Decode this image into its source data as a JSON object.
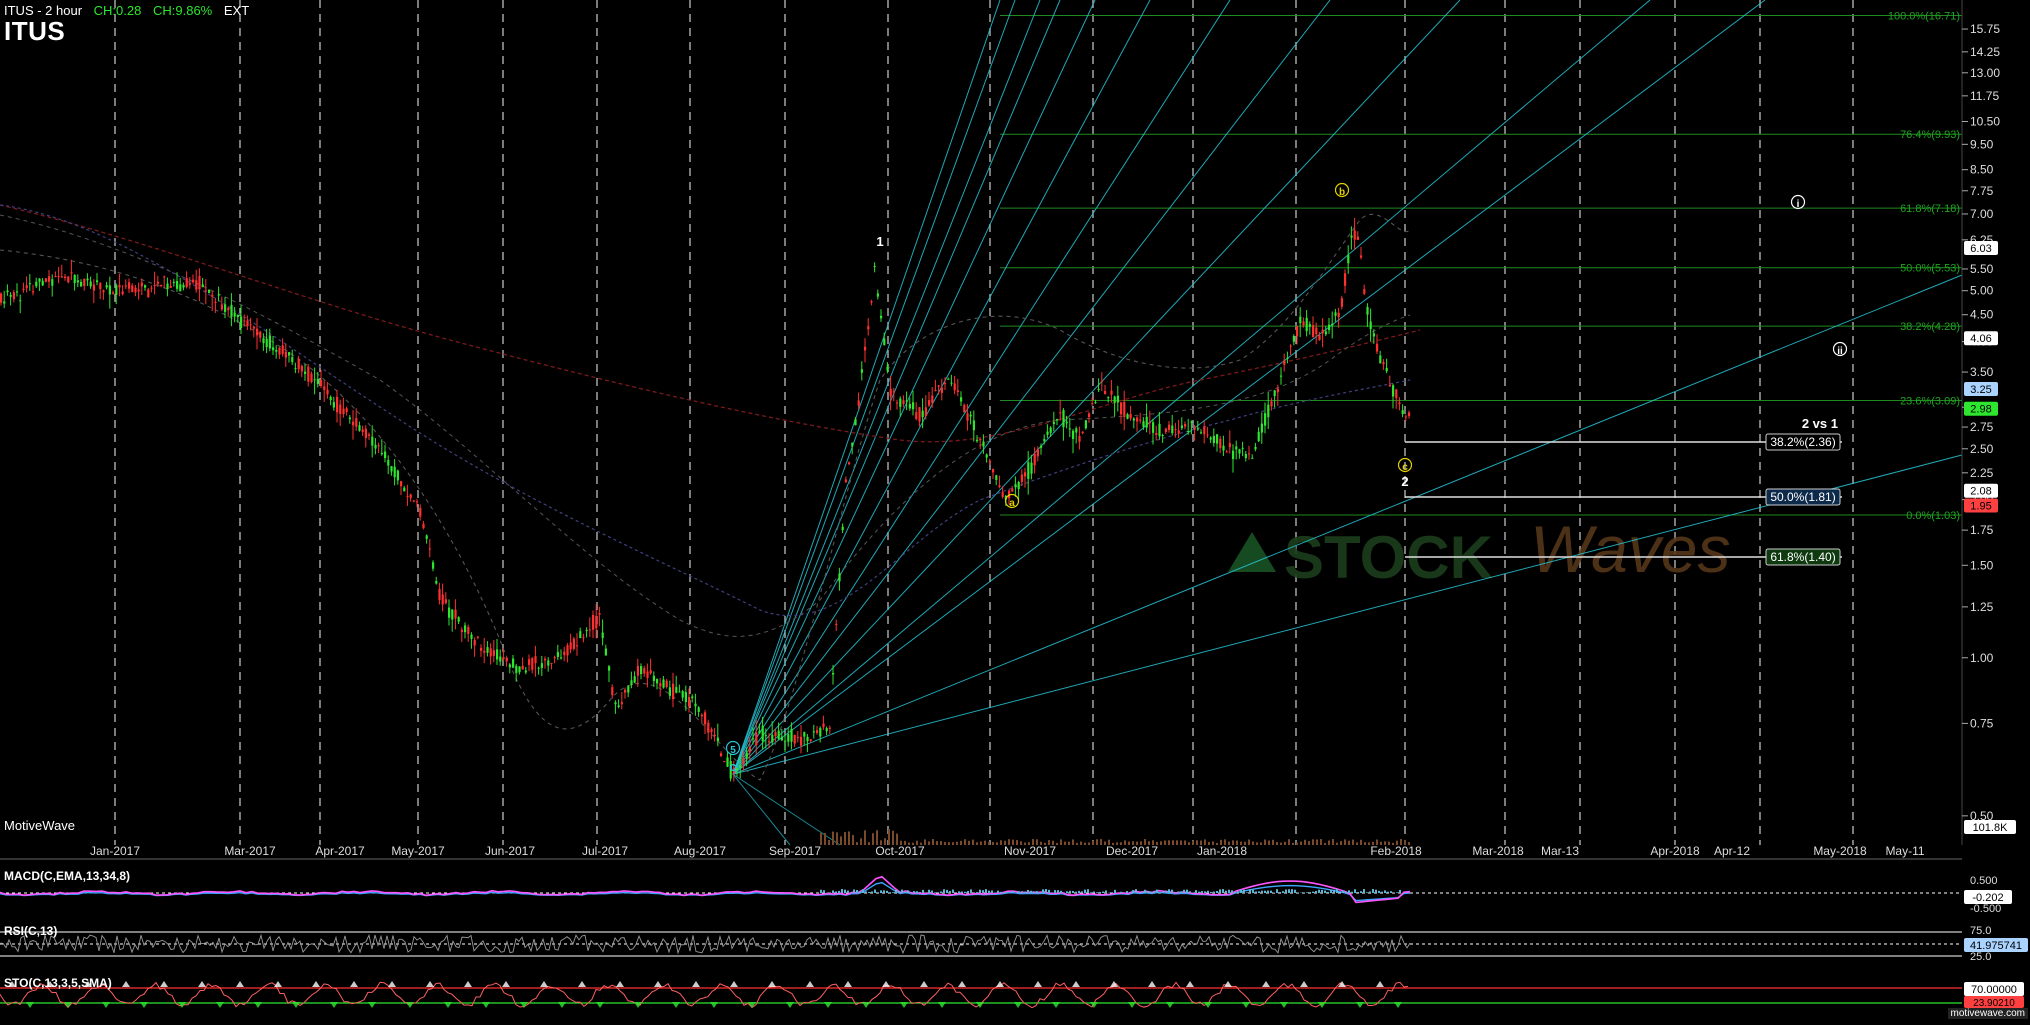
{
  "header": {
    "symbol_interval": "ITUS - 2 hour",
    "change": "CH:0.28",
    "change_pct": "CH:9.86%",
    "ext": "EXT",
    "ticker": "ITUS"
  },
  "branding": {
    "motivewave": "MotiveWave",
    "footer_url": "motivewave.com",
    "watermark_left": "STOCK",
    "watermark_right": "Waves"
  },
  "colors": {
    "background": "#000000",
    "grid": "#cfcfcf",
    "fib_line": "#1f8a1f",
    "fib_label": "#1fa51f",
    "fan_line": "#26c6d6",
    "bullish_candle": "#2ee62e",
    "bearish_candle": "#ff3030",
    "macd_line": "#ff55ff",
    "macd_signal": "#3aa6ff",
    "macd_hist": "#5ab8d6",
    "stoch_line": "#ff6060",
    "stoch_overbought": "#ff3030",
    "stoch_oversold": "#2ee62e"
  },
  "chart_data": {
    "type": "candlestick",
    "y_scale": "log",
    "y_ticks": [
      "15.75",
      "14.25",
      "13.00",
      "11.75",
      "10.50",
      "9.50",
      "8.50",
      "7.75",
      "7.00",
      "6.25",
      "5.50",
      "5.00",
      "4.50",
      "4.00",
      "3.50",
      "3.00",
      "2.75",
      "2.50",
      "2.25",
      "2.00",
      "1.75",
      "1.50",
      "1.25",
      "1.00",
      "0.75",
      "0.50"
    ],
    "ylim": [
      0.44,
      17.5
    ],
    "x_ticks": [
      "Jan-2017",
      "Mar-2017",
      "Apr-2017",
      "May-2017",
      "Jun-2017",
      "Jul-2017",
      "Aug-2017",
      "Sep-2017",
      "Oct-2017",
      "Nov-2017",
      "Dec-2017",
      "Jan-2018",
      "Feb-2018",
      "Mar-2018",
      "Mar-13",
      "Apr-2018",
      "Apr-12",
      "May-2018",
      "May-11"
    ],
    "price_path": [
      [
        "Dec-2016",
        4.8
      ],
      [
        "Jan-2017",
        5.2
      ],
      [
        "Feb-2017",
        5.0
      ],
      [
        "Mar-2017",
        4.2
      ],
      [
        "Apr-2017",
        3.1
      ],
      [
        "May-2017",
        2.0
      ],
      [
        "Jun-2017",
        0.95
      ],
      [
        "Jul-2017",
        1.1
      ],
      [
        "Aug-2017",
        0.78
      ],
      [
        "Aug-2017 end",
        0.6
      ],
      [
        "Sep-2017",
        0.7
      ],
      [
        "Sep-2017 end",
        3.0
      ],
      [
        "Oct-2017 start",
        5.5
      ],
      [
        "Oct-2017",
        3.0
      ],
      [
        "Nov-2017",
        2.0
      ],
      [
        "Nov-2017 mid",
        2.8
      ],
      [
        "Dec-2017",
        2.9
      ],
      [
        "Jan-2018",
        2.4
      ],
      [
        "Jan-2018 mid",
        4.4
      ],
      [
        "Jan-2018 end",
        7.0
      ],
      [
        "Feb-2018",
        3.5
      ],
      [
        "Feb-2018 mid",
        2.98
      ]
    ],
    "price_badges": [
      {
        "text": "6.03",
        "value": 6.03,
        "bg": "#ffffff",
        "fg": "#000000"
      },
      {
        "text": "4.06",
        "value": 4.06,
        "bg": "#ffffff",
        "fg": "#000000"
      },
      {
        "text": "3.25",
        "value": 3.25,
        "bg": "#aad4ff",
        "fg": "#000000"
      },
      {
        "text": "2.98",
        "value": 2.98,
        "bg": "#2ee62e",
        "fg": "#000000"
      },
      {
        "text": "2.08",
        "value": 2.08,
        "bg": "#ffffff",
        "fg": "#000000"
      },
      {
        "text": "1.95",
        "value": 1.95,
        "bg": "#ff4040",
        "fg": "#000000"
      }
    ],
    "volume_badge": "101.8K",
    "fib_retracements": [
      {
        "label": "100.0%(16.71)",
        "value": 16.71
      },
      {
        "label": "76.4%(9.93)",
        "value": 9.93
      },
      {
        "label": "61.8%(7.18)",
        "value": 7.18
      },
      {
        "label": "50.0%(5.53)",
        "value": 5.53
      },
      {
        "label": "38.2%(4.28)",
        "value": 4.28
      },
      {
        "label": "23.6%(3.09)",
        "value": 3.09
      },
      {
        "label": "0.0%(1.03)",
        "value": 1.87
      }
    ],
    "wave2_projection": {
      "title": "2 vs 1",
      "levels": [
        {
          "label": "38.2%(2.36)",
          "value": 2.36
        },
        {
          "label": "50.0%(1.81)",
          "value": 1.81
        },
        {
          "label": "61.8%(1.40)",
          "value": 1.4
        }
      ]
    },
    "wave_labels": [
      {
        "text": "1",
        "color": "#ffffff"
      },
      {
        "text": "5",
        "color": "#26c6d6",
        "circled": true
      },
      {
        "text": "c",
        "color": "#26c6d6"
      },
      {
        "text": "a",
        "color": "#e6d200",
        "circled": true
      },
      {
        "text": "b",
        "color": "#e6d200",
        "circled": true
      },
      {
        "text": "c",
        "color": "#e6d200",
        "circled": true
      },
      {
        "text": "2",
        "color": "#ffffff"
      },
      {
        "text": "i",
        "color": "#ffffff",
        "circled": true
      },
      {
        "text": "ii",
        "color": "#ffffff",
        "circled": true
      }
    ]
  },
  "indicators": {
    "macd": {
      "label": "MACD(C,EMA,13,34,8)",
      "ticks": [
        "0.500",
        "-0.500"
      ],
      "value": "-0.202"
    },
    "rsi": {
      "label": "RSI(C,13)",
      "ticks": [
        "75.0",
        "25.0"
      ],
      "value": "41.975741"
    },
    "stoch": {
      "label": "STO(C,13,3,5,SMA)",
      "value_overbought": "70.00000",
      "value_current": "23.90210"
    }
  }
}
